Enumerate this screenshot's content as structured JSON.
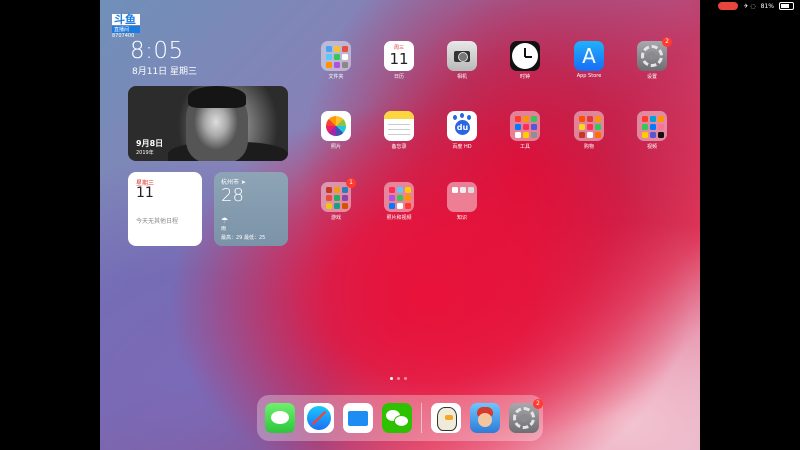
{
  "status_bar": {
    "battery": "81%"
  },
  "overlay_logo": {
    "mark": "斗鱼",
    "sub": "直播间",
    "room": "8707400"
  },
  "lock": {
    "time": "8:05",
    "date": "8月11日 星期三"
  },
  "photo_widget": {
    "title": "9月8日",
    "year": "2019年"
  },
  "calendar_widget": {
    "weekday": "星期三",
    "day": "11",
    "empty_text": "今天无其他日程"
  },
  "weather_widget": {
    "city": "杭州市 ➤",
    "temp": "28",
    "icon": "cloud-rain-icon",
    "condition": "雨",
    "hilo": "最高：29 最低：25"
  },
  "apps": [
    {
      "label": "文件夹",
      "badge": ""
    },
    {
      "label": "日历",
      "weekday": "周三",
      "day": "11",
      "badge": ""
    },
    {
      "label": "相机",
      "badge": ""
    },
    {
      "label": "时钟",
      "badge": ""
    },
    {
      "label": "App Store",
      "badge": ""
    },
    {
      "label": "设置",
      "badge": "2"
    },
    {
      "label": "照片",
      "badge": ""
    },
    {
      "label": "备忘录",
      "badge": ""
    },
    {
      "label": "百度 HD",
      "badge": ""
    },
    {
      "label": "工具",
      "badge": ""
    },
    {
      "label": "购物",
      "badge": ""
    },
    {
      "label": "视频",
      "badge": ""
    },
    {
      "label": "游戏",
      "badge": "1"
    },
    {
      "label": "照片和视频",
      "badge": ""
    },
    {
      "label": "知识",
      "badge": ""
    }
  ],
  "dock": {
    "items": [
      "messages-icon",
      "safari-icon",
      "files-icon",
      "wechat-icon",
      "eagle-app-icon",
      "game-avatar-icon",
      "settings-icon"
    ],
    "settings_badge": "2"
  },
  "colors": {
    "badge": "#ff3b30",
    "dock_bg": "rgba(255,255,255,0.3)"
  }
}
